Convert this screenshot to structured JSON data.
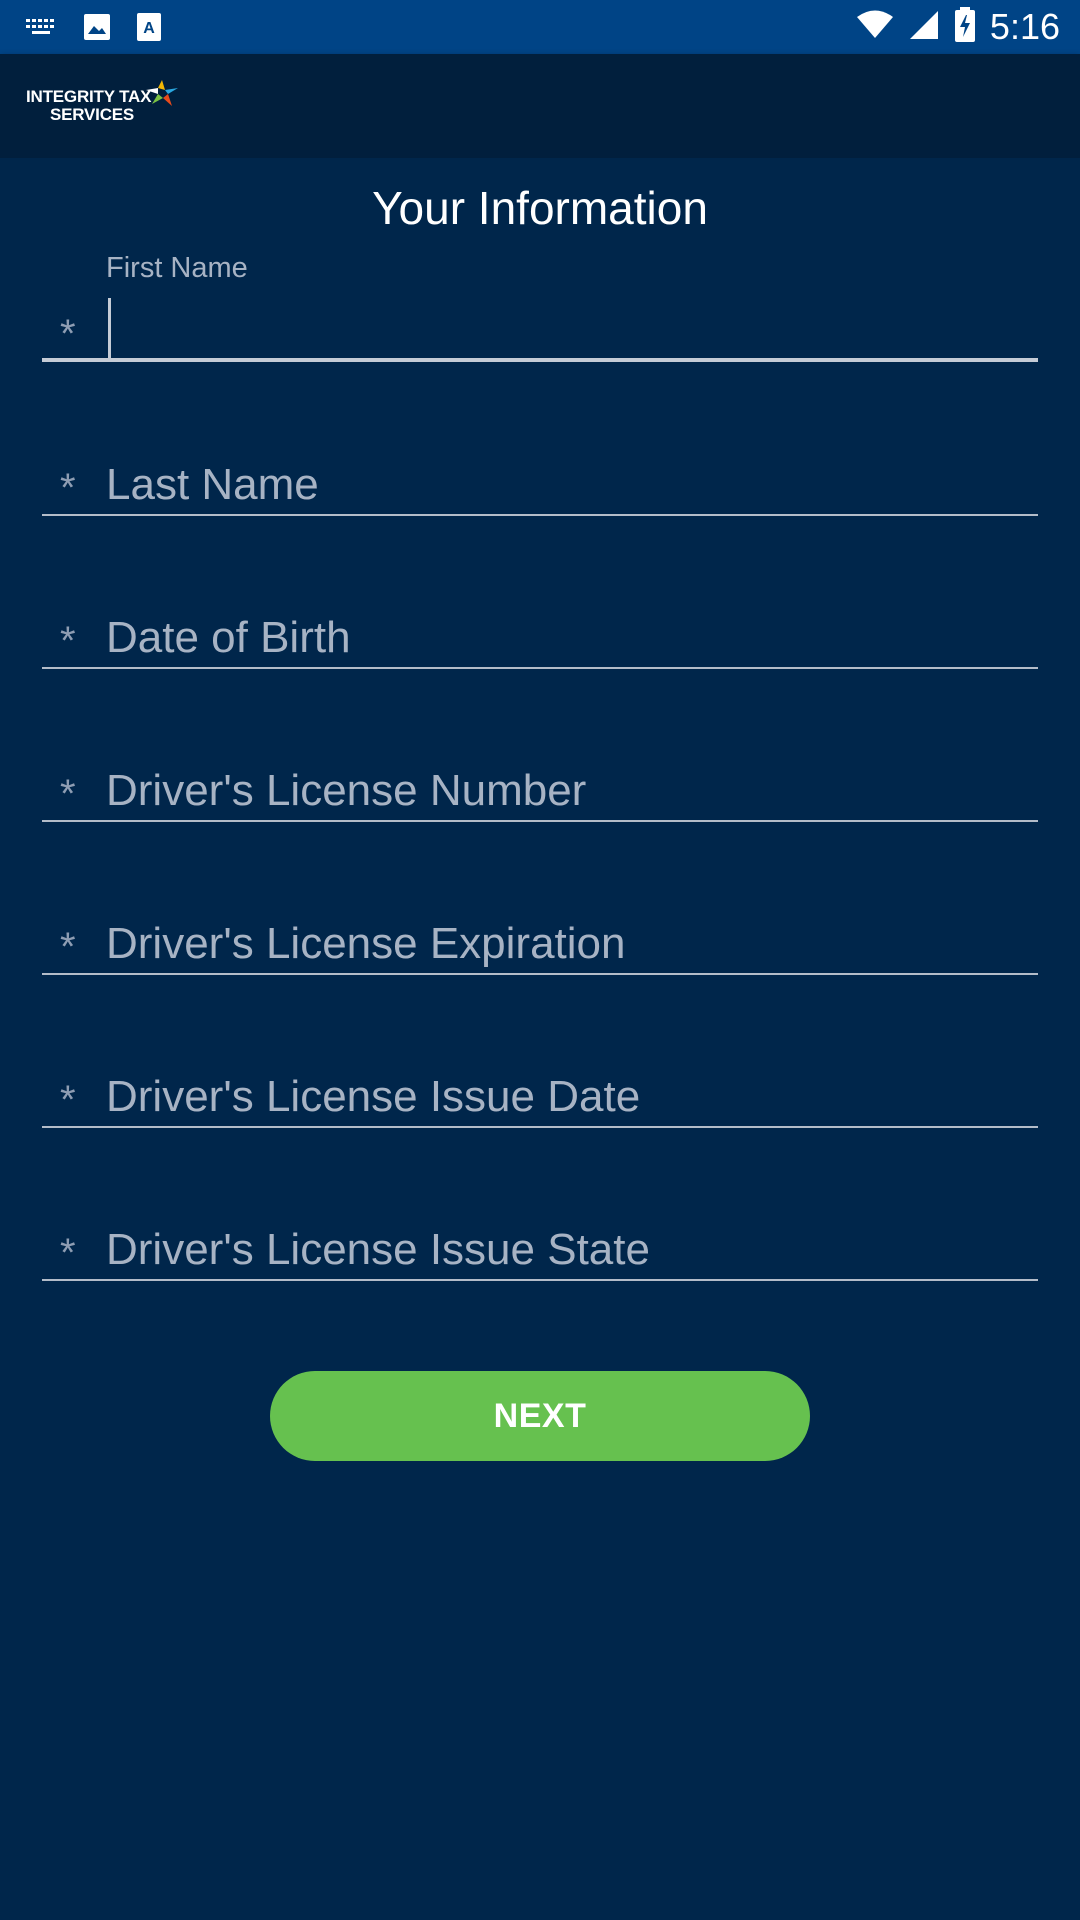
{
  "status_bar": {
    "time": "5:16",
    "icons": [
      "keyboard-icon",
      "image-icon",
      "text-icon",
      "wifi-icon",
      "signal-icon",
      "battery-charging-icon"
    ]
  },
  "app_bar": {
    "logo_line1": "INTEGRITY TAX",
    "logo_line2": "SERVICES"
  },
  "page": {
    "title": "Your Information"
  },
  "form": {
    "required_marker": "*",
    "fields": [
      {
        "label": "First Name",
        "value": "",
        "focused": true
      },
      {
        "label": "Last Name",
        "value": ""
      },
      {
        "label": "Date of Birth",
        "value": ""
      },
      {
        "label": "Driver's License Number",
        "value": ""
      },
      {
        "label": "Driver's License Expiration",
        "value": ""
      },
      {
        "label": "Driver's License Issue Date",
        "value": ""
      },
      {
        "label": "Driver's License Issue State",
        "value": ""
      }
    ],
    "next_label": "NEXT"
  },
  "colors": {
    "background": "#00264b",
    "status_bar": "#004486",
    "app_bar": "#011f3d",
    "accent_button": "#66c14f"
  }
}
